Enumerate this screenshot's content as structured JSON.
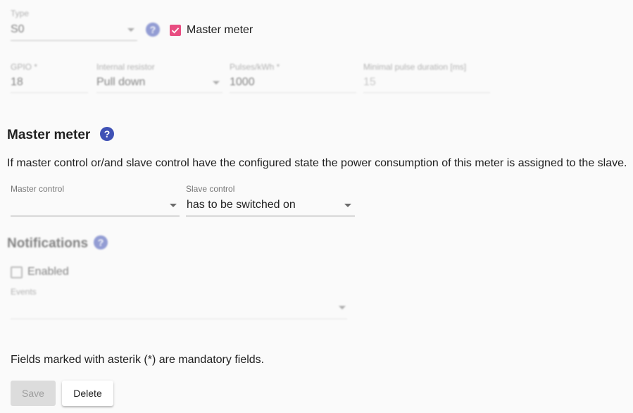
{
  "type_field": {
    "label": "Type",
    "value": "S0"
  },
  "master_meter_checkbox": {
    "label": "Master meter",
    "checked": true
  },
  "gpio_field": {
    "label": "GPIO *",
    "value": "18"
  },
  "internal_resistor_field": {
    "label": "Internal resistor",
    "value": "Pull down"
  },
  "pulses_field": {
    "label": "Pulses/kWh *",
    "value": "1000"
  },
  "min_pulse_field": {
    "label": "Minimal pulse duration [ms]",
    "value": "15"
  },
  "master_meter_section": {
    "title": "Master meter",
    "description": "If master control or/and slave control have the configured state the power consumption of this meter is assigned to the slave.",
    "master_control": {
      "label": "Master control",
      "value": ""
    },
    "slave_control": {
      "label": "Slave control",
      "value": "has to be switched on"
    }
  },
  "notifications_section": {
    "title": "Notifications",
    "enabled_label": "Enabled",
    "events_label": "Events",
    "events_value": ""
  },
  "footer": {
    "mandatory_note": "Fields marked with asterik (*) are mandatory fields.",
    "save_label": "Save",
    "delete_label": "Delete"
  },
  "colors": {
    "accent_pink": "#e84d81",
    "help_icon_blue": "#3f51b5",
    "background": "#fafafa"
  },
  "icons": [
    "help-icon",
    "dropdown-arrow-icon",
    "checkbox-checked-icon",
    "checkbox-empty-icon"
  ]
}
